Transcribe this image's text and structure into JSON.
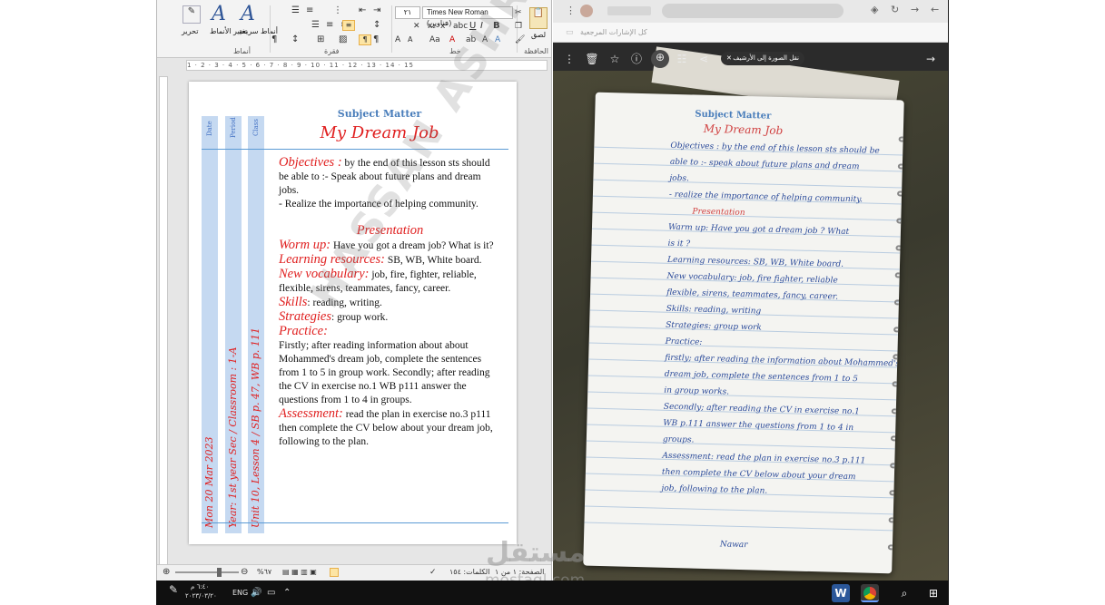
{
  "ribbon": {
    "styles_group": "أنماط",
    "style_btn": "أنماط سريعة",
    "change_styles": "تغيير الأنماط",
    "edit_btn": "تحرير",
    "paragraph_group": "فقرة",
    "font_group": "خط",
    "clipboard_group": "الحافظة",
    "paste_btn": "لصق",
    "font_name": "Times New Roman (عناوين)",
    "font_size": "٢١"
  },
  "ruler_text": "1 · 2 · 3 · 4 · 5 · 6 · 7 · 8 · 9 · 10 · 11 · 12 · 13 · 14 · 15",
  "document": {
    "col_date": "Date",
    "col_period": "Period",
    "col_class": "Class",
    "side_date": "Mon 20 Mar 2023",
    "side_period": "Year: 1st year Sec / Classroom : 1-A",
    "side_class": "Unit 10, Lesson 4 / SB p. 47, WB p. 111",
    "subject": "Subject Matter",
    "title": "My Dream Job",
    "objectives_label": "Objectives :",
    "objectives_text": "by the end of this lesson sts should be able to :- Speak about future plans and dream jobs.",
    "objectives_text2": "- Realize the importance of helping community.",
    "presentation": "Presentation",
    "warmup_label": "Worm up:",
    "warmup_text": "Have you got a dream job? What is it?",
    "resources_label": "Learning resources:",
    "resources_text": "SB, WB, White board.",
    "vocab_label": "New vocabulary:",
    "vocab_text": "job, fire, fighter, reliable, flexible, sirens, teammates, fancy, career.",
    "skills_label": "Skills",
    "skills_text": ": reading, writing.",
    "strategies_label": "Strategies",
    "strategies_text": ": group work.",
    "practice_label": "Practice:",
    "practice_text": "Firstly; after reading information about about Mohammed's dream job, complete the sentences from 1 to 5 in group work. Secondly; after reading the CV in exercise no.1 WB p111 answer the questions from 1 to 4 in groups.",
    "assessment_label": "Assessment:",
    "assessment_text": "read the plan in exercise no.3 p111 then complete the CV below about your dream job, following to the plan."
  },
  "statusbar": {
    "page": "الصفحة: ١ من ١",
    "words": "الكلمات: ١٥٤",
    "zoom": "%٦٧"
  },
  "viewer": {
    "bookmarks_label": "كل الإشارات المرجعية",
    "move_chip": "نقل الصورة إلى الأرشيف",
    "notebook_title": "Subject Matter",
    "notebook_sub": "My Dream Job",
    "hand_lines": [
      "Objectives : by the end of this lesson sts should be",
      "able to :- speak about future plans and dream",
      "jobs.",
      "- realize the importance of helping community.",
      "Presentation",
      "Warm up: Have you got a dream job ? What",
      "is it ?",
      "Learning resources: SB, WB, White board.",
      "New vocabulary: job, fire fighter, reliable",
      "flexible, sirens, teammates, fancy, career.",
      "Skills: reading, writing",
      "Strategies: group work",
      "Practice:",
      "firstly; after reading the information about Mohammed's",
      "dream job, complete the sentences from 1 to 5",
      "in group works.",
      "Secondly; after reading the CV in exercise no.1",
      "WB p.111 answer the questions from 1 to 4 in",
      "groups.",
      "Assessment: read the plan in exercise no.3 p.111",
      "then complete the CV below about your dream",
      "job, following to the plan."
    ],
    "signature": "Nawar"
  },
  "watermark": "HASSAN ASHRAF",
  "logo": {
    "mark": "مستقل",
    "url": "mostaql.com"
  },
  "taskbar": {
    "clock_time": "٦:٤٠ م",
    "clock_date": "٢٠٢٣/٠٣/٢٠",
    "lang": "ENG"
  }
}
